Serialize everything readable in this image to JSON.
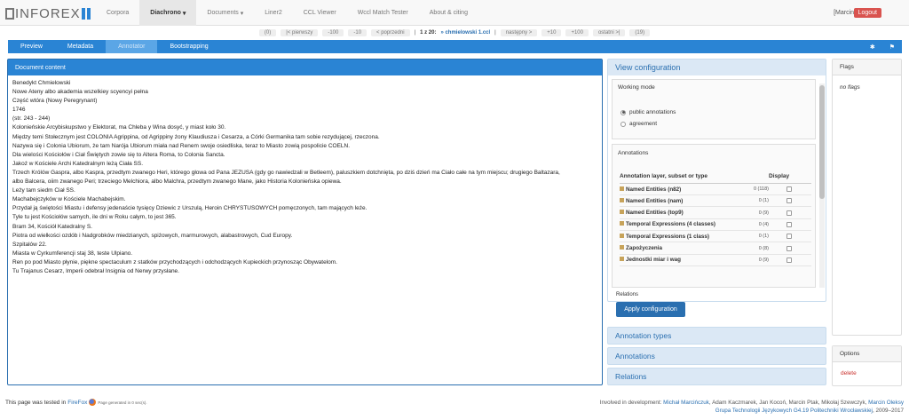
{
  "nav": {
    "logo": "INFOREX",
    "items": [
      "Corpora",
      "Diachrono",
      "Documents",
      "Liner2",
      "CCL Viewer",
      "Wccl Match Tester",
      "About & citing"
    ],
    "user": "[Marcin]",
    "logout": "Logout"
  },
  "pager": {
    "zero": "(0)",
    "first": "|< pierwszy",
    "m100": "-100",
    "m10": "-10",
    "prev": "< poprzedni",
    "sep": "|",
    "pos": "1 z 20:",
    "file": "» chmielowski 1.ccl",
    "next": "następny >",
    "p10": "+10",
    "p100": "+100",
    "last": "ostatni >|",
    "total": "(19)"
  },
  "tabs": [
    "Preview",
    "Metadata",
    "Annotator",
    "Bootstrapping"
  ],
  "doc": {
    "title": "Document content",
    "lines": [
      "Benedykt Chmielowski",
      "Nowe Ateny albo akademia wszelkiey scyencyi pełna",
      "Część wtóra (Nowy Peregrynant)",
      "1746",
      "(str. 243 - 244)",
      "Kolonieńskie Arcybiskupstwo y Elektorat, ma Chleba y Wina dosyć, y miast koło 30.",
      "Między temi Stołecznym jest COLONIA Agrippina, od Agrippiny żony Klaudiusza i Cesarza, a Córki Germanika tam sobie rezydującej, rzeczona.",
      "Nazywa się i Colonia Ubiorum, że tam Narója Ubiorum miała nad Renem swoje osiedliska, teraz to Miasto zowią pospolicie COELN.",
      "Dla wielości Kościołów i Ciał Świętych zowie się to Altera Roma, to Colonia Sancta.",
      "Jakoż w Kościele Archi Katedralnym leżą Ciała SS.",
      "Trzech Królów Gaspra, albo Kaspra, przedtym zwanego Heri, którego głowa od Pana JEZUSA (gdy go nawiedzali w Betleem), paluszkiem dotchnięta, po dziś dzień ma Ciało całe na tym miejscu; drugiego Baltazara,",
      "albo Balcera, oiim zwanego Peri; trzeciego Melchiora, albo Malchra, przedtym zwanego Mane, jako Historia Kolonieńska opiewa.",
      "Leży tam siedm Ciał SS.",
      "Machabejczyków w Kościele Machabejskim.",
      "Przydał ją świętości Miastu i defensy jedenaście tysięcy Dziewic z Urszulą, Heroin CHRYSTUSOWYCH pomęczonych, tam mających leże.",
      "Tyle tu jest Kościołów samych, ile dni w Roku całym, to jest 365.",
      "Bram 34, Kościół Katedralny S.",
      "Piotra od wielkości ozdób i Nadgrobków miedzianych, spiżowych, marmurowych, alabastrowych, Cud Europy.",
      "Szpitalów 22.",
      "Miasta w Cyrkumferencji staj 38, teste Ulpiano.",
      "Ren po pod Miasto płynie, piękne spectaculum z statków przychodzących i odchodzących Kupieckich przynosząc Obywatelom.",
      "Tu Trajanus Cesarz, Imperii odebrał Insignia od Nerwy przysłane."
    ]
  },
  "view": {
    "title": "View configuration",
    "working_mode": "Working mode",
    "opt_public": "public annotations",
    "opt_agreement": "agreement",
    "annotations": "Annotations",
    "col_layer": "Annotation layer, subset or type",
    "col_display": "Display",
    "rows": [
      {
        "label": "Named Entities (n82)",
        "count": "0 (118)"
      },
      {
        "label": "Named Entities (nam)",
        "count": "0 (1)"
      },
      {
        "label": "Named Entities (top9)",
        "count": "0 (9)"
      },
      {
        "label": "Temporal Expressions (4 classes)",
        "count": "0 (4)"
      },
      {
        "label": "Temporal Expressions (1 class)",
        "count": "0 (1)"
      },
      {
        "label": "Zapożyczenia",
        "count": "0 (8)"
      },
      {
        "label": "Jednostki miar i wag",
        "count": "0 (9)"
      }
    ],
    "relations": "Relations",
    "apply": "Apply configuration"
  },
  "sections": [
    "Annotation types",
    "Annotations",
    "Relations"
  ],
  "flags": {
    "title": "Flags",
    "body": "no flags"
  },
  "options": {
    "title": "Options",
    "delete": "delete"
  },
  "footer": {
    "tested": "This page was tested in",
    "firefox": "FireFox",
    "generated": "Page generated in 0 sec(s).",
    "dev": "Involved in development:",
    "people": "Michał Marcińczuk",
    "people_rest": ", Adam Kaczmarek, Jan Kocoń, Marcin Ptak, Mikołaj Szewczyk,",
    "people_last": "Marcin Oleksy",
    "group": "Grupa Technologii Językowych G4.19 Politechniki Wrocławskiej",
    "years": ", 2009–2017"
  }
}
